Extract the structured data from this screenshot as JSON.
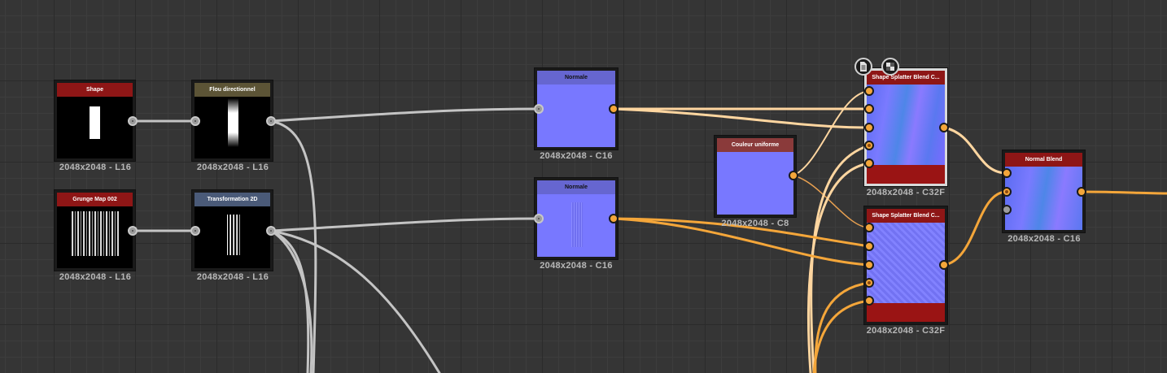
{
  "nodes": {
    "shape": {
      "title": "Shape",
      "res": "2048x2048 - L16",
      "title_color": "#8e1616"
    },
    "flou": {
      "title": "Flou directionnel",
      "res": "2048x2048 - L16",
      "title_color": "#5c5436"
    },
    "grunge": {
      "title": "Grunge Map 002",
      "res": "2048x2048 - L16",
      "title_color": "#8e1616"
    },
    "transform": {
      "title": "Transformation 2D",
      "res": "2048x2048 - L16",
      "title_color": "#4a5a78"
    },
    "normale1": {
      "title": "Normale",
      "res": "2048x2048 - C16",
      "title_color": "#6666d0"
    },
    "normale2": {
      "title": "Normale",
      "res": "2048x2048 - C16",
      "title_color": "#6666d0"
    },
    "couleur": {
      "title": "Couleur uniforme",
      "res": "2048x2048 - C8",
      "title_color": "#8a3a3a"
    },
    "splatter1": {
      "title": "Shape Splatter Blend C...",
      "res": "2048x2048 - C32F",
      "title_color": "#8e1616"
    },
    "splatter2": {
      "title": "Shape Splatter Blend C...",
      "res": "2048x2048 - C32F",
      "title_color": "#8e1616"
    },
    "normalblend": {
      "title": "Normal Blend",
      "res": "2048x2048 - C16",
      "title_color": "#8e1616"
    }
  },
  "icons": {
    "output": "document-icon",
    "preview": "checker-icon"
  },
  "colors": {
    "wire_gray": "#c4c4c4",
    "wire_orange": "#f4a63a",
    "wire_light_orange": "#ffd6a0",
    "normal_map": "#7777ff"
  }
}
